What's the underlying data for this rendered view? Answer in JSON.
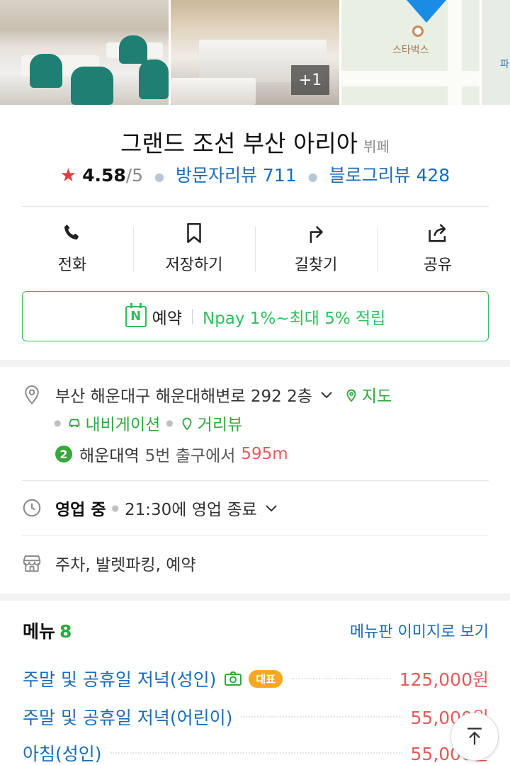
{
  "photos": {
    "more_count": "+1",
    "map_poi": "스타벅스",
    "map_label": "파"
  },
  "place": {
    "name": "그랜드 조선 부산 아리아",
    "category": "뷔페",
    "rating_star": "★",
    "rating": "4.58",
    "rating_max": "/5",
    "visitor_reviews": "방문자리뷰 711",
    "blog_reviews": "블로그리뷰 428"
  },
  "actions": [
    {
      "label": "전화",
      "icon": "phone-icon"
    },
    {
      "label": "저장하기",
      "icon": "bookmark-icon"
    },
    {
      "label": "길찾기",
      "icon": "directions-icon"
    },
    {
      "label": "공유",
      "icon": "share-icon"
    }
  ],
  "reserve": {
    "label": "예약",
    "npay": "Npay 1%~최대 5% 적립"
  },
  "info": {
    "address": "부산 해운대구 해운대해변로 292 2층",
    "map_link": "지도",
    "navigation_link": "내비게이션",
    "streetview_link": "거리뷰",
    "subway_line": "2",
    "station": "해운대역",
    "exit_text": "5번 출구에서",
    "distance": "595m",
    "status": "영업 중",
    "close_time": "21:30에 영업 종료",
    "amenities": "주차, 발렛파킹, 예약"
  },
  "menu": {
    "title": "메뉴",
    "count": "8",
    "board_link": "메뉴판 이미지로 보기",
    "items": [
      {
        "name": "주말 및 공휴일 저녁(성인)",
        "badge": "대표",
        "price": "125,000원"
      },
      {
        "name": "주말 및 공휴일 저녁(어린이)",
        "price": "55,000원"
      },
      {
        "name": "아침(성인)",
        "price": "55,000원"
      }
    ]
  },
  "colors": {
    "accent_green": "#2fbf5a",
    "link_blue": "#1b6cb8",
    "price_red": "#e35a5a",
    "star_red": "#e23d3d"
  }
}
